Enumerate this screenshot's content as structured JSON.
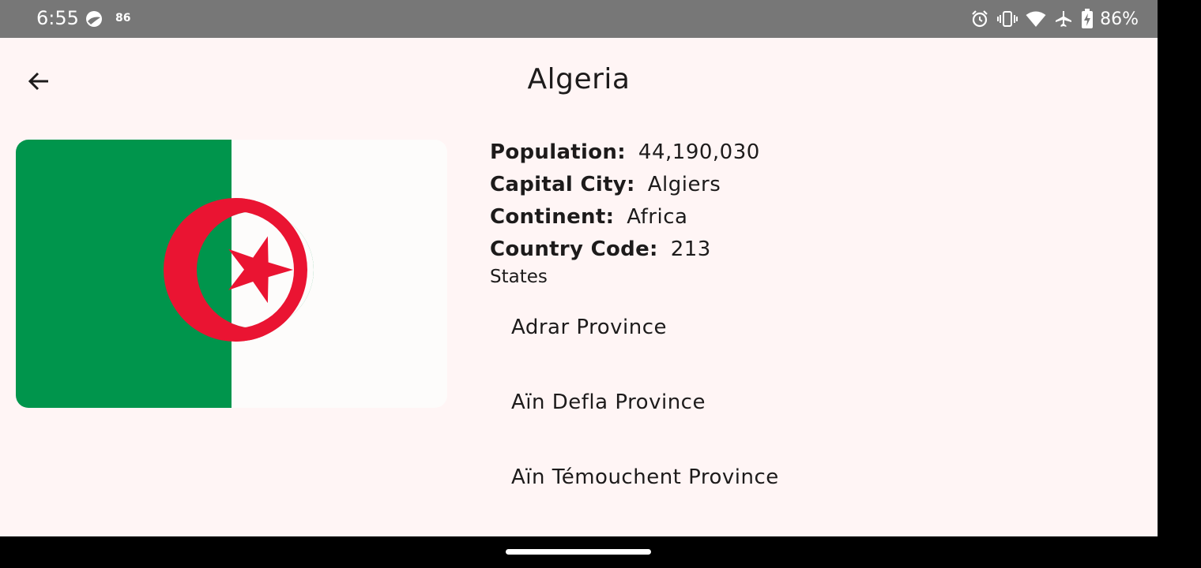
{
  "status_bar": {
    "time": "6:55",
    "notification_count": "86",
    "battery": "86%"
  },
  "app_bar": {
    "title": "Algeria"
  },
  "flag": {
    "green": "#00954c",
    "white": "#fdfcfb",
    "red": "#ea1432"
  },
  "details": {
    "population_label": "Population:",
    "population_value": "44,190,030",
    "capital_label": "Capital City:",
    "capital_value": "Algiers",
    "continent_label": "Continent:",
    "continent_value": "Africa",
    "code_label": "Country Code:",
    "code_value": "213"
  },
  "states": {
    "heading": "States",
    "items": [
      "Adrar Province",
      "Aïn Defla Province",
      "Aïn Témouchent Province"
    ]
  },
  "colors": {
    "background": "#fff5f5",
    "status_bar": "#777777",
    "text": "#1d1b1b"
  }
}
